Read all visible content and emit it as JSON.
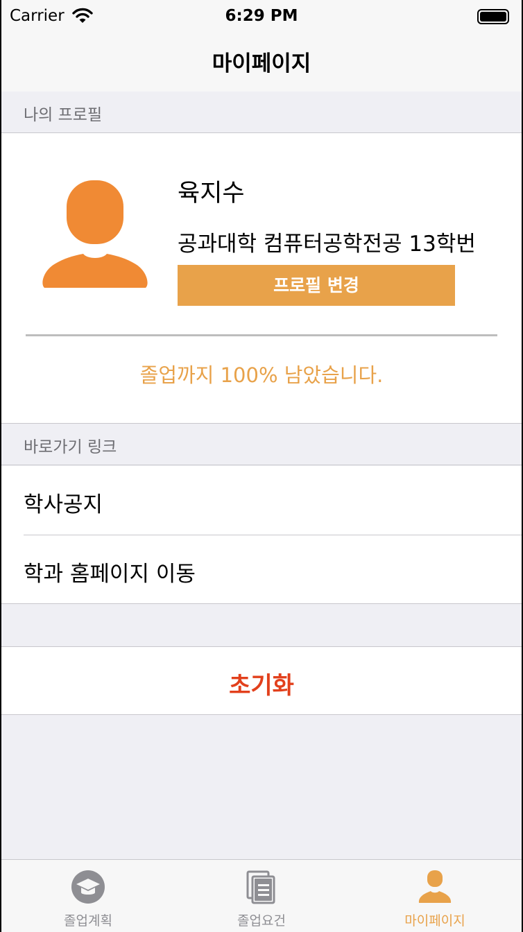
{
  "status_bar": {
    "carrier": "Carrier",
    "time": "6:29 PM"
  },
  "nav": {
    "title": "마이페이지"
  },
  "profile_section": {
    "header": "나의 프로필",
    "name": "육지수",
    "department": "공과대학 컴퓨터공학전공 13학번",
    "edit_button": "프로필 변경",
    "progress_text": "졸업까지 100% 남았습니다."
  },
  "links_section": {
    "header": "바로가기 링크",
    "items": [
      {
        "label": "학사공지"
      },
      {
        "label": "학과 홈페이지 이동"
      }
    ]
  },
  "reset": {
    "label": "초기화"
  },
  "tabs": [
    {
      "label": "졸업계획",
      "icon": "graduation-cap-icon"
    },
    {
      "label": "졸업요건",
      "icon": "documents-icon"
    },
    {
      "label": "마이페이지",
      "icon": "person-icon"
    }
  ],
  "colors": {
    "accent": "#e8a24a",
    "avatar": "#f08a34",
    "destructive": "#e2401c",
    "tab_inactive": "#8e8e93"
  }
}
